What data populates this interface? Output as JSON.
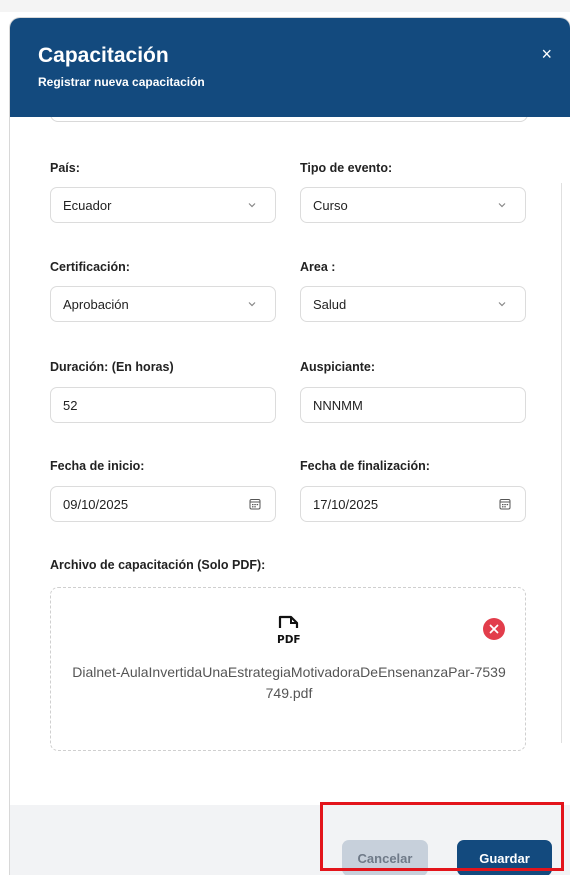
{
  "modal": {
    "title": "Capacitación",
    "subtitle": "Registrar nueva capacitación",
    "close_glyph": "×"
  },
  "fields": {
    "pais": {
      "label": "País:",
      "value": "Ecuador"
    },
    "tipo_evento": {
      "label": "Tipo de evento:",
      "value": "Curso"
    },
    "certificacion": {
      "label": "Certificación:",
      "value": "Aprobación"
    },
    "area": {
      "label": "Area :",
      "value": "Salud"
    },
    "duracion": {
      "label": "Duración: (En horas)",
      "value": "52"
    },
    "auspiciante": {
      "label": "Auspiciante:",
      "value": "NNNMM"
    },
    "fecha_inicio": {
      "label": "Fecha de inicio:",
      "value": "09/10/2025"
    },
    "fecha_fin": {
      "label": "Fecha de finalización:",
      "value": "17/10/2025"
    }
  },
  "archivo": {
    "label": "Archivo de capacitación (Solo PDF):",
    "file_name": "Dialnet-AulaInvertidaUnaEstrategiaMotivadoraDeEnsenanzaPar-7539749.pdf",
    "icon": "pdf-file-icon"
  },
  "buttons": {
    "cancel": "Cancelar",
    "save": "Guardar"
  },
  "colors": {
    "primary": "#134a7e",
    "danger": "#e23d4b",
    "highlight": "#e3141b"
  }
}
